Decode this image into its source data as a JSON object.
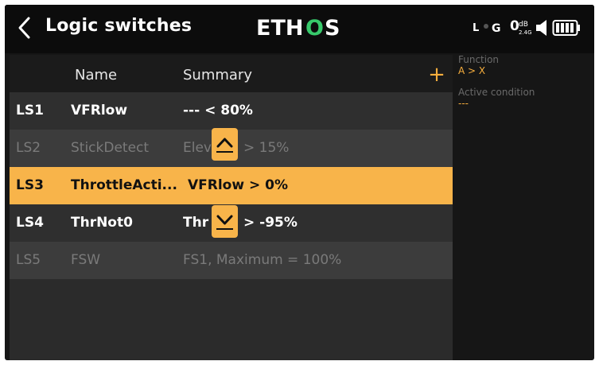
{
  "header": {
    "title": "Logic switches",
    "logo": "ETHOS",
    "status": {
      "l_label": "L",
      "g_label": "G",
      "rssi": "0",
      "rssi_unit": "dB",
      "band": "2.4G"
    }
  },
  "list": {
    "columns": {
      "name": "Name",
      "summary": "Summary"
    },
    "add_label": "+",
    "rows": [
      {
        "id": "LS1",
        "name": "VFRlow",
        "summary": "--- < 80%"
      },
      {
        "id": "LS2",
        "name": "StickDetect",
        "summary_a": "Elev",
        "summary_b": "> 15%"
      },
      {
        "id": "LS3",
        "name": "ThrottleActi...",
        "summary": "VFRlow > 0%"
      },
      {
        "id": "LS4",
        "name": "ThrNot0",
        "summary_a": "Thr",
        "summary_b": "> -95%"
      },
      {
        "id": "LS5",
        "name": "FSW",
        "summary": "FS1, Maximum = 100%"
      }
    ]
  },
  "info": {
    "function_label": "Function",
    "function_value": "A > X",
    "condition_label": "Active condition",
    "condition_value": "---"
  },
  "colors": {
    "accent": "#f8b44a",
    "logo_green": "#37c96b"
  }
}
